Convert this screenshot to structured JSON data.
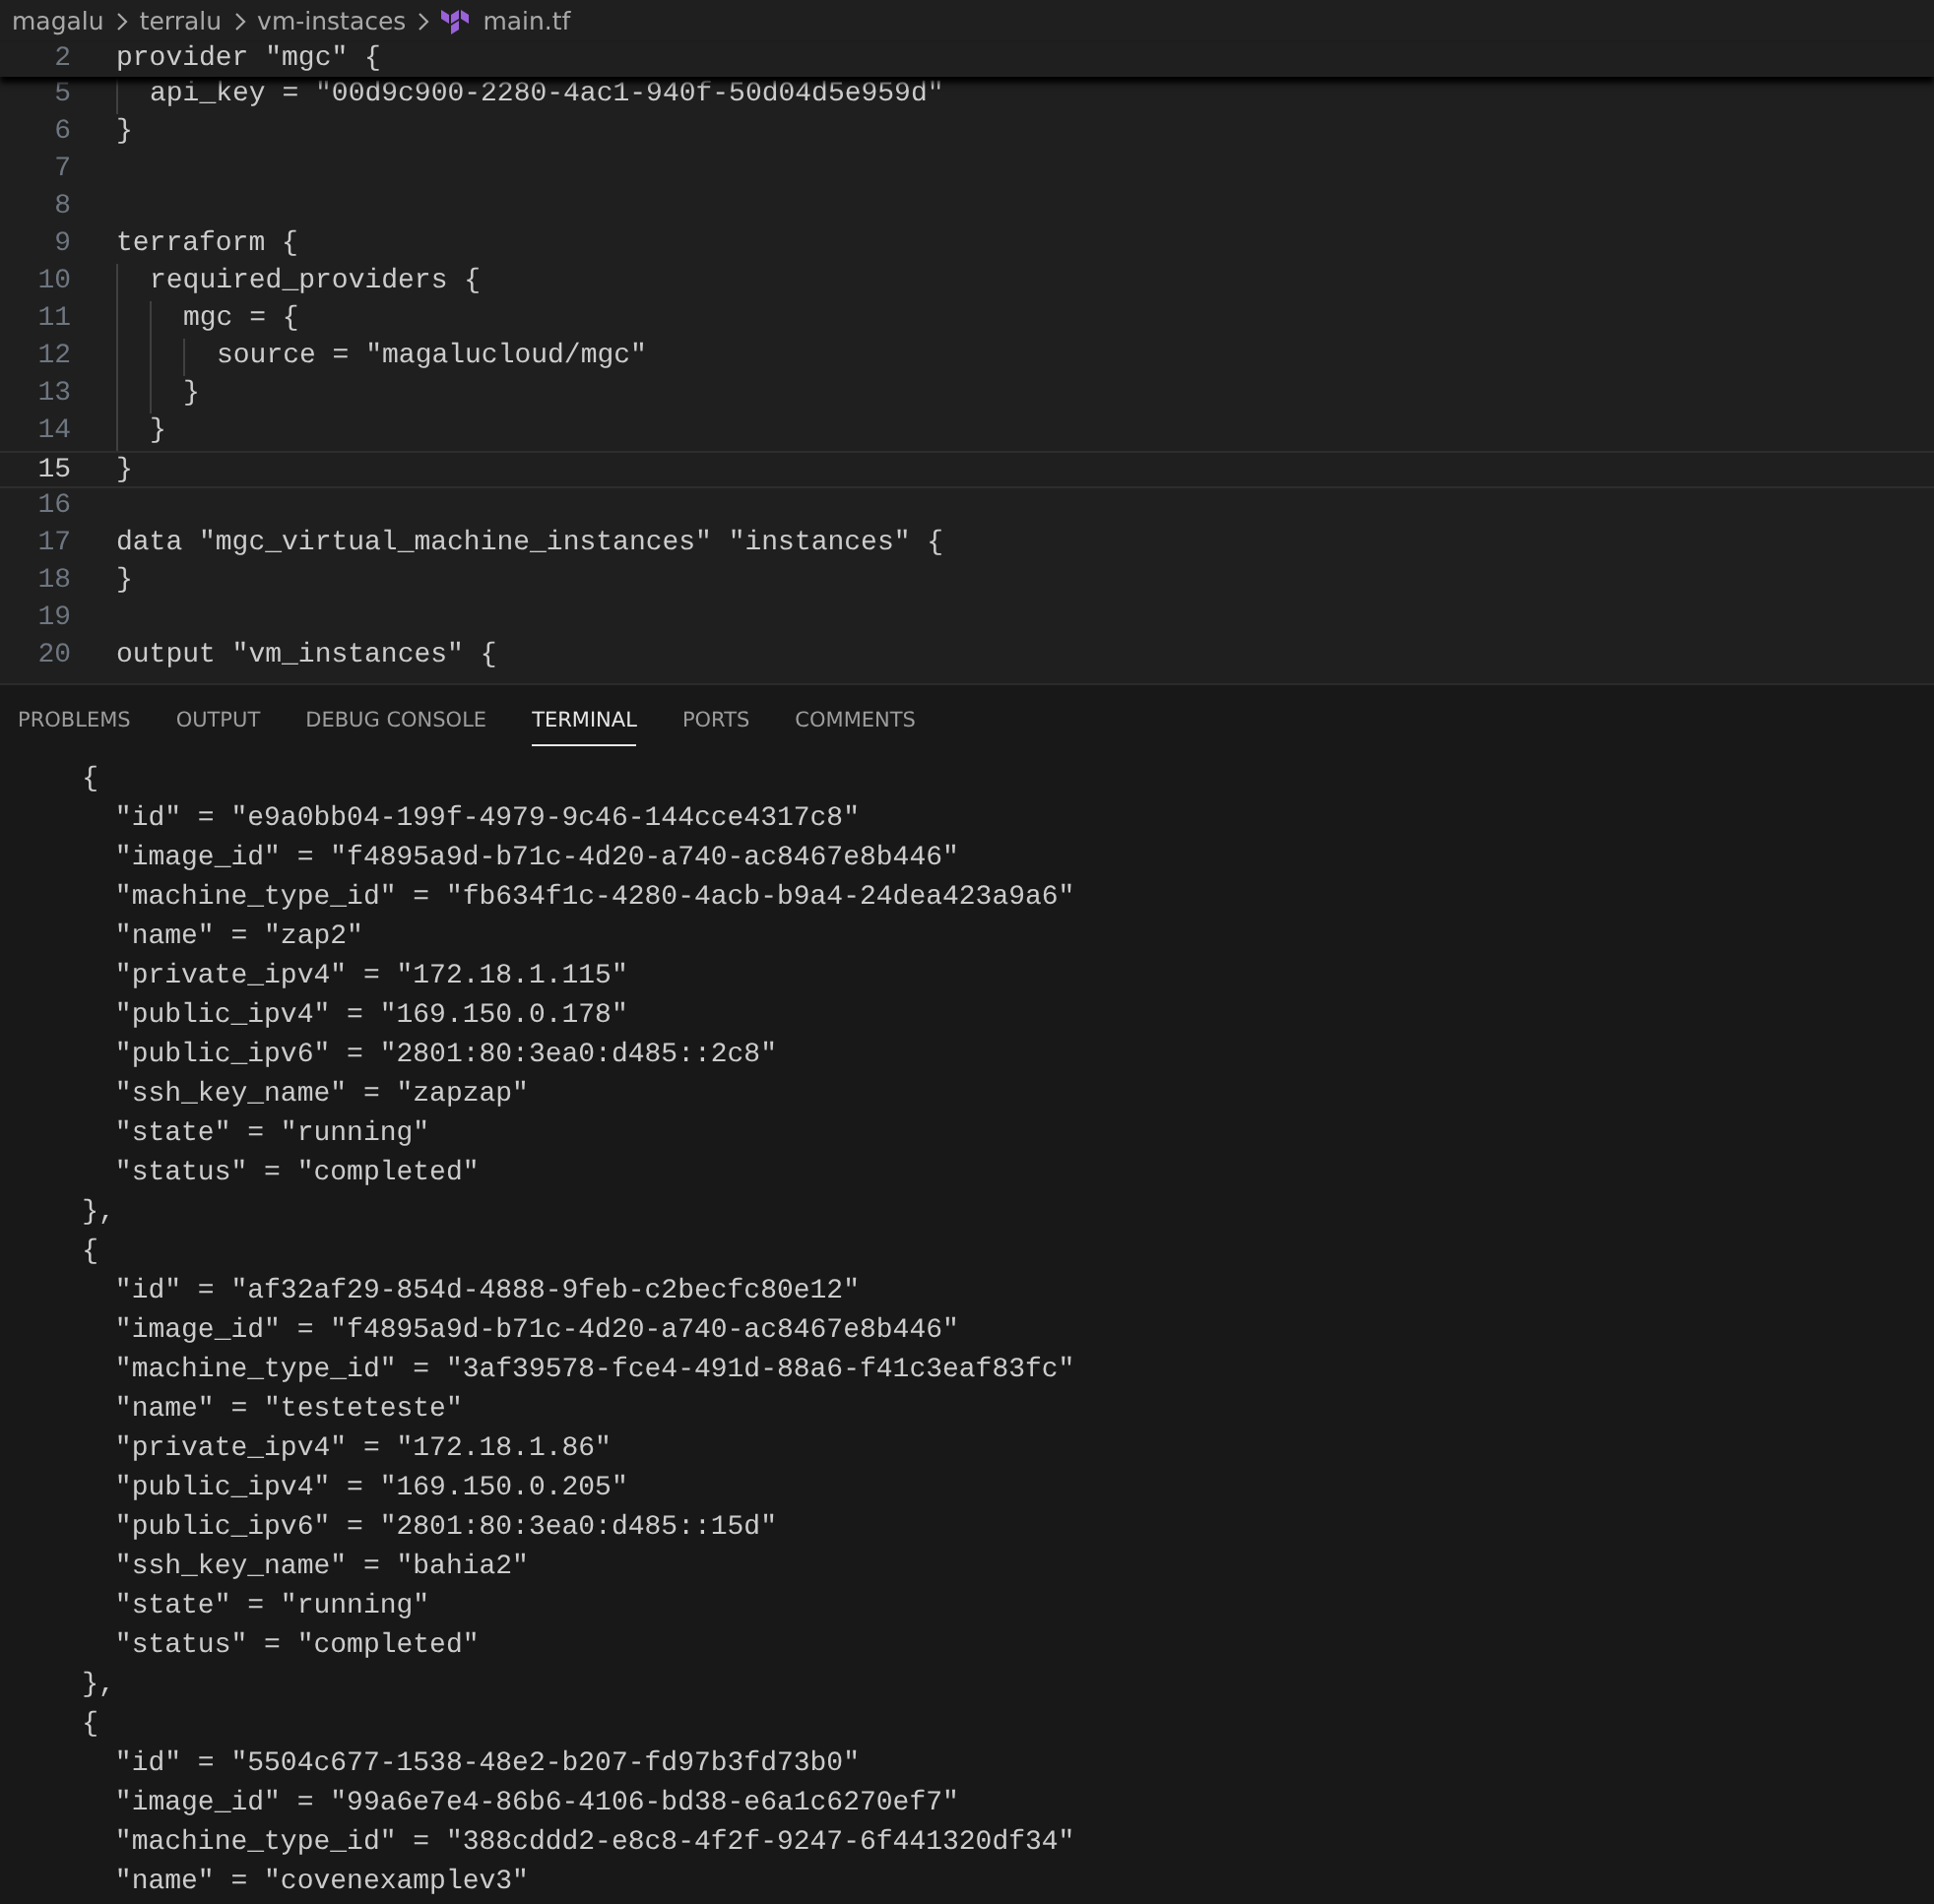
{
  "breadcrumb": [
    {
      "label": "magalu",
      "kind": "folder"
    },
    {
      "label": "terralu",
      "kind": "folder"
    },
    {
      "label": "vm-instaces",
      "kind": "folder"
    },
    {
      "label": "main.tf",
      "kind": "file"
    }
  ],
  "editor": {
    "sticky_line": {
      "number": "2",
      "text": "provider \"mgc\" {"
    },
    "lines": [
      {
        "number": "5",
        "text": "  api_key = \"00d9c900-2280-4ac1-940f-50d04d5e959d\"",
        "current": false
      },
      {
        "number": "6",
        "text": "}",
        "current": false
      },
      {
        "number": "7",
        "current": false
      },
      {
        "number": "8",
        "current": false
      },
      {
        "number": "9",
        "text": "terraform {",
        "current": false
      },
      {
        "number": "10",
        "text": "  required_providers {",
        "current": false
      },
      {
        "number": "11",
        "text": "    mgc = {",
        "current": false
      },
      {
        "number": "12",
        "text": "      source = \"magalucloud/mgc\"",
        "current": false
      },
      {
        "number": "13",
        "text": "    }",
        "current": false
      },
      {
        "number": "14",
        "text": "  }",
        "current": false
      },
      {
        "number": "15",
        "text": "}",
        "current": true
      },
      {
        "number": "16",
        "current": false
      },
      {
        "number": "17",
        "text": "data \"mgc_virtual_machine_instances\" \"instances\" {",
        "current": false
      },
      {
        "number": "18",
        "text": "}",
        "current": false
      },
      {
        "number": "19",
        "current": false
      },
      {
        "number": "20",
        "text": "output \"vm_instances\" {",
        "current": false
      }
    ]
  },
  "panel": {
    "tabs": [
      {
        "label": "PROBLEMS",
        "selected": false
      },
      {
        "label": "OUTPUT",
        "selected": false
      },
      {
        "label": "DEBUG CONSOLE",
        "selected": false
      },
      {
        "label": "TERMINAL",
        "selected": true
      },
      {
        "label": "PORTS",
        "selected": false
      },
      {
        "label": "COMMENTS",
        "selected": false
      }
    ],
    "terminal_lines": [
      "    {",
      "      \"id\" = \"e9a0bb04-199f-4979-9c46-144cce4317c8\"",
      "      \"image_id\" = \"f4895a9d-b71c-4d20-a740-ac8467e8b446\"",
      "      \"machine_type_id\" = \"fb634f1c-4280-4acb-b9a4-24dea423a9a6\"",
      "      \"name\" = \"zap2\"",
      "      \"private_ipv4\" = \"172.18.1.115\"",
      "      \"public_ipv4\" = \"169.150.0.178\"",
      "      \"public_ipv6\" = \"2801:80:3ea0:d485::2c8\"",
      "      \"ssh_key_name\" = \"zapzap\"",
      "      \"state\" = \"running\"",
      "      \"status\" = \"completed\"",
      "    },",
      "    {",
      "      \"id\" = \"af32af29-854d-4888-9feb-c2becfc80e12\"",
      "      \"image_id\" = \"f4895a9d-b71c-4d20-a740-ac8467e8b446\"",
      "      \"machine_type_id\" = \"3af39578-fce4-491d-88a6-f41c3eaf83fc\"",
      "      \"name\" = \"testeteste\"",
      "      \"private_ipv4\" = \"172.18.1.86\"",
      "      \"public_ipv4\" = \"169.150.0.205\"",
      "      \"public_ipv6\" = \"2801:80:3ea0:d485::15d\"",
      "      \"ssh_key_name\" = \"bahia2\"",
      "      \"state\" = \"running\"",
      "      \"status\" = \"completed\"",
      "    },",
      "    {",
      "      \"id\" = \"5504c677-1538-48e2-b207-fd97b3fd73b0\"",
      "      \"image_id\" = \"99a6e7e4-86b6-4106-bd38-e6a1c6270ef7\"",
      "      \"machine_type_id\" = \"388cddd2-e8c8-4f2f-9247-6f441320df34\"",
      "      \"name\" = \"covenexamplev3\""
    ]
  }
}
